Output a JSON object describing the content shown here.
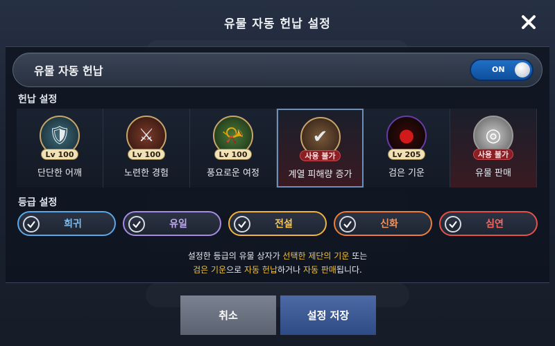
{
  "title": "유물 자동 헌납 설정",
  "toggle": {
    "label": "유물 자동 헌납",
    "state": "ON"
  },
  "donation_section": {
    "label": "헌납 설정",
    "cards": [
      {
        "name": "단단한 어깨",
        "badge": "Lv 100",
        "badge_type": "level",
        "icon": "shoulder-armor-icon",
        "glyph": "🛡"
      },
      {
        "name": "노련한 경험",
        "badge": "Lv 100",
        "badge_type": "level",
        "icon": "sword-upgrade-icon",
        "glyph": "⚔"
      },
      {
        "name": "풍요로운 여정",
        "badge": "Lv 100",
        "badge_type": "level",
        "icon": "horn-of-plenty-icon",
        "glyph": "📯"
      },
      {
        "name": "계열 피해량 증가",
        "badge": "사용 불가",
        "badge_type": "unavailable",
        "icon": "element-shield-icon",
        "glyph": "✔"
      },
      {
        "name": "검은 기운",
        "badge": "Lv 205",
        "badge_type": "level",
        "icon": "dark-aura-icon",
        "glyph": "●"
      },
      {
        "name": "유물 판매",
        "badge": "사용 불가",
        "badge_type": "unavailable",
        "icon": "coin-pile-icon",
        "glyph": "◎"
      }
    ]
  },
  "grade_section": {
    "label": "등급 설정",
    "grades": [
      {
        "name": "희귀",
        "color": "#5aa8e8"
      },
      {
        "name": "유일",
        "color": "#a98be6"
      },
      {
        "name": "전설",
        "color": "#f2b43a"
      },
      {
        "name": "신화",
        "color": "#f07e3a"
      },
      {
        "name": "심연",
        "color": "#e8504a"
      }
    ]
  },
  "info": {
    "line1_a": "설정한 등급의 유물 상자가 ",
    "line1_b": "선택한 제단의 기운",
    "line1_c": " 또는",
    "line2_a": "검은 기운",
    "line2_b": "으로 ",
    "line2_c": "자동 헌납",
    "line2_d": "하거나 ",
    "line2_e": "자동 판매",
    "line2_f": "됩니다."
  },
  "buttons": {
    "cancel": "취소",
    "save": "설정 저장"
  },
  "colors": {
    "highlight": "#f1c23a",
    "switch_on": "#1f6fc7"
  }
}
